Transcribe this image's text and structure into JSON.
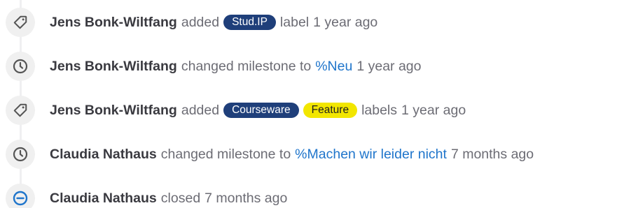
{
  "events": [
    {
      "icon": "tag-icon",
      "author": "Jens Bonk-Wiltfang",
      "action": "added",
      "labels": [
        {
          "text": "Stud.IP",
          "color": "#1f3f7a",
          "text_color": "#ffffff"
        }
      ],
      "suffix": "label",
      "time": "1 year ago"
    },
    {
      "icon": "clock-icon",
      "author": "Jens Bonk-Wiltfang",
      "action": "changed milestone to",
      "milestone": "%Neu",
      "time": "1 year ago"
    },
    {
      "icon": "tag-icon",
      "author": "Jens Bonk-Wiltfang",
      "action": "added",
      "labels": [
        {
          "text": "Courseware",
          "color": "#1f3f7a",
          "text_color": "#ffffff"
        },
        {
          "text": "Feature",
          "color": "#f2e600",
          "text_color": "#1e1e1e"
        }
      ],
      "suffix": "labels",
      "time": "1 year ago"
    },
    {
      "icon": "clock-icon",
      "author": "Claudia Nathaus",
      "action": "changed milestone to",
      "milestone": "%Machen wir leider nicht",
      "time": "7 months ago"
    },
    {
      "icon": "closed-circle-icon",
      "author": "Claudia Nathaus",
      "action": "closed",
      "time": "7 months ago"
    }
  ],
  "colors": {
    "link": "#1f75cb",
    "muted_text": "#6c6c74",
    "author_text": "#3a3a40",
    "closed_icon": "#1f75cb",
    "icon_gray": "#555555"
  }
}
